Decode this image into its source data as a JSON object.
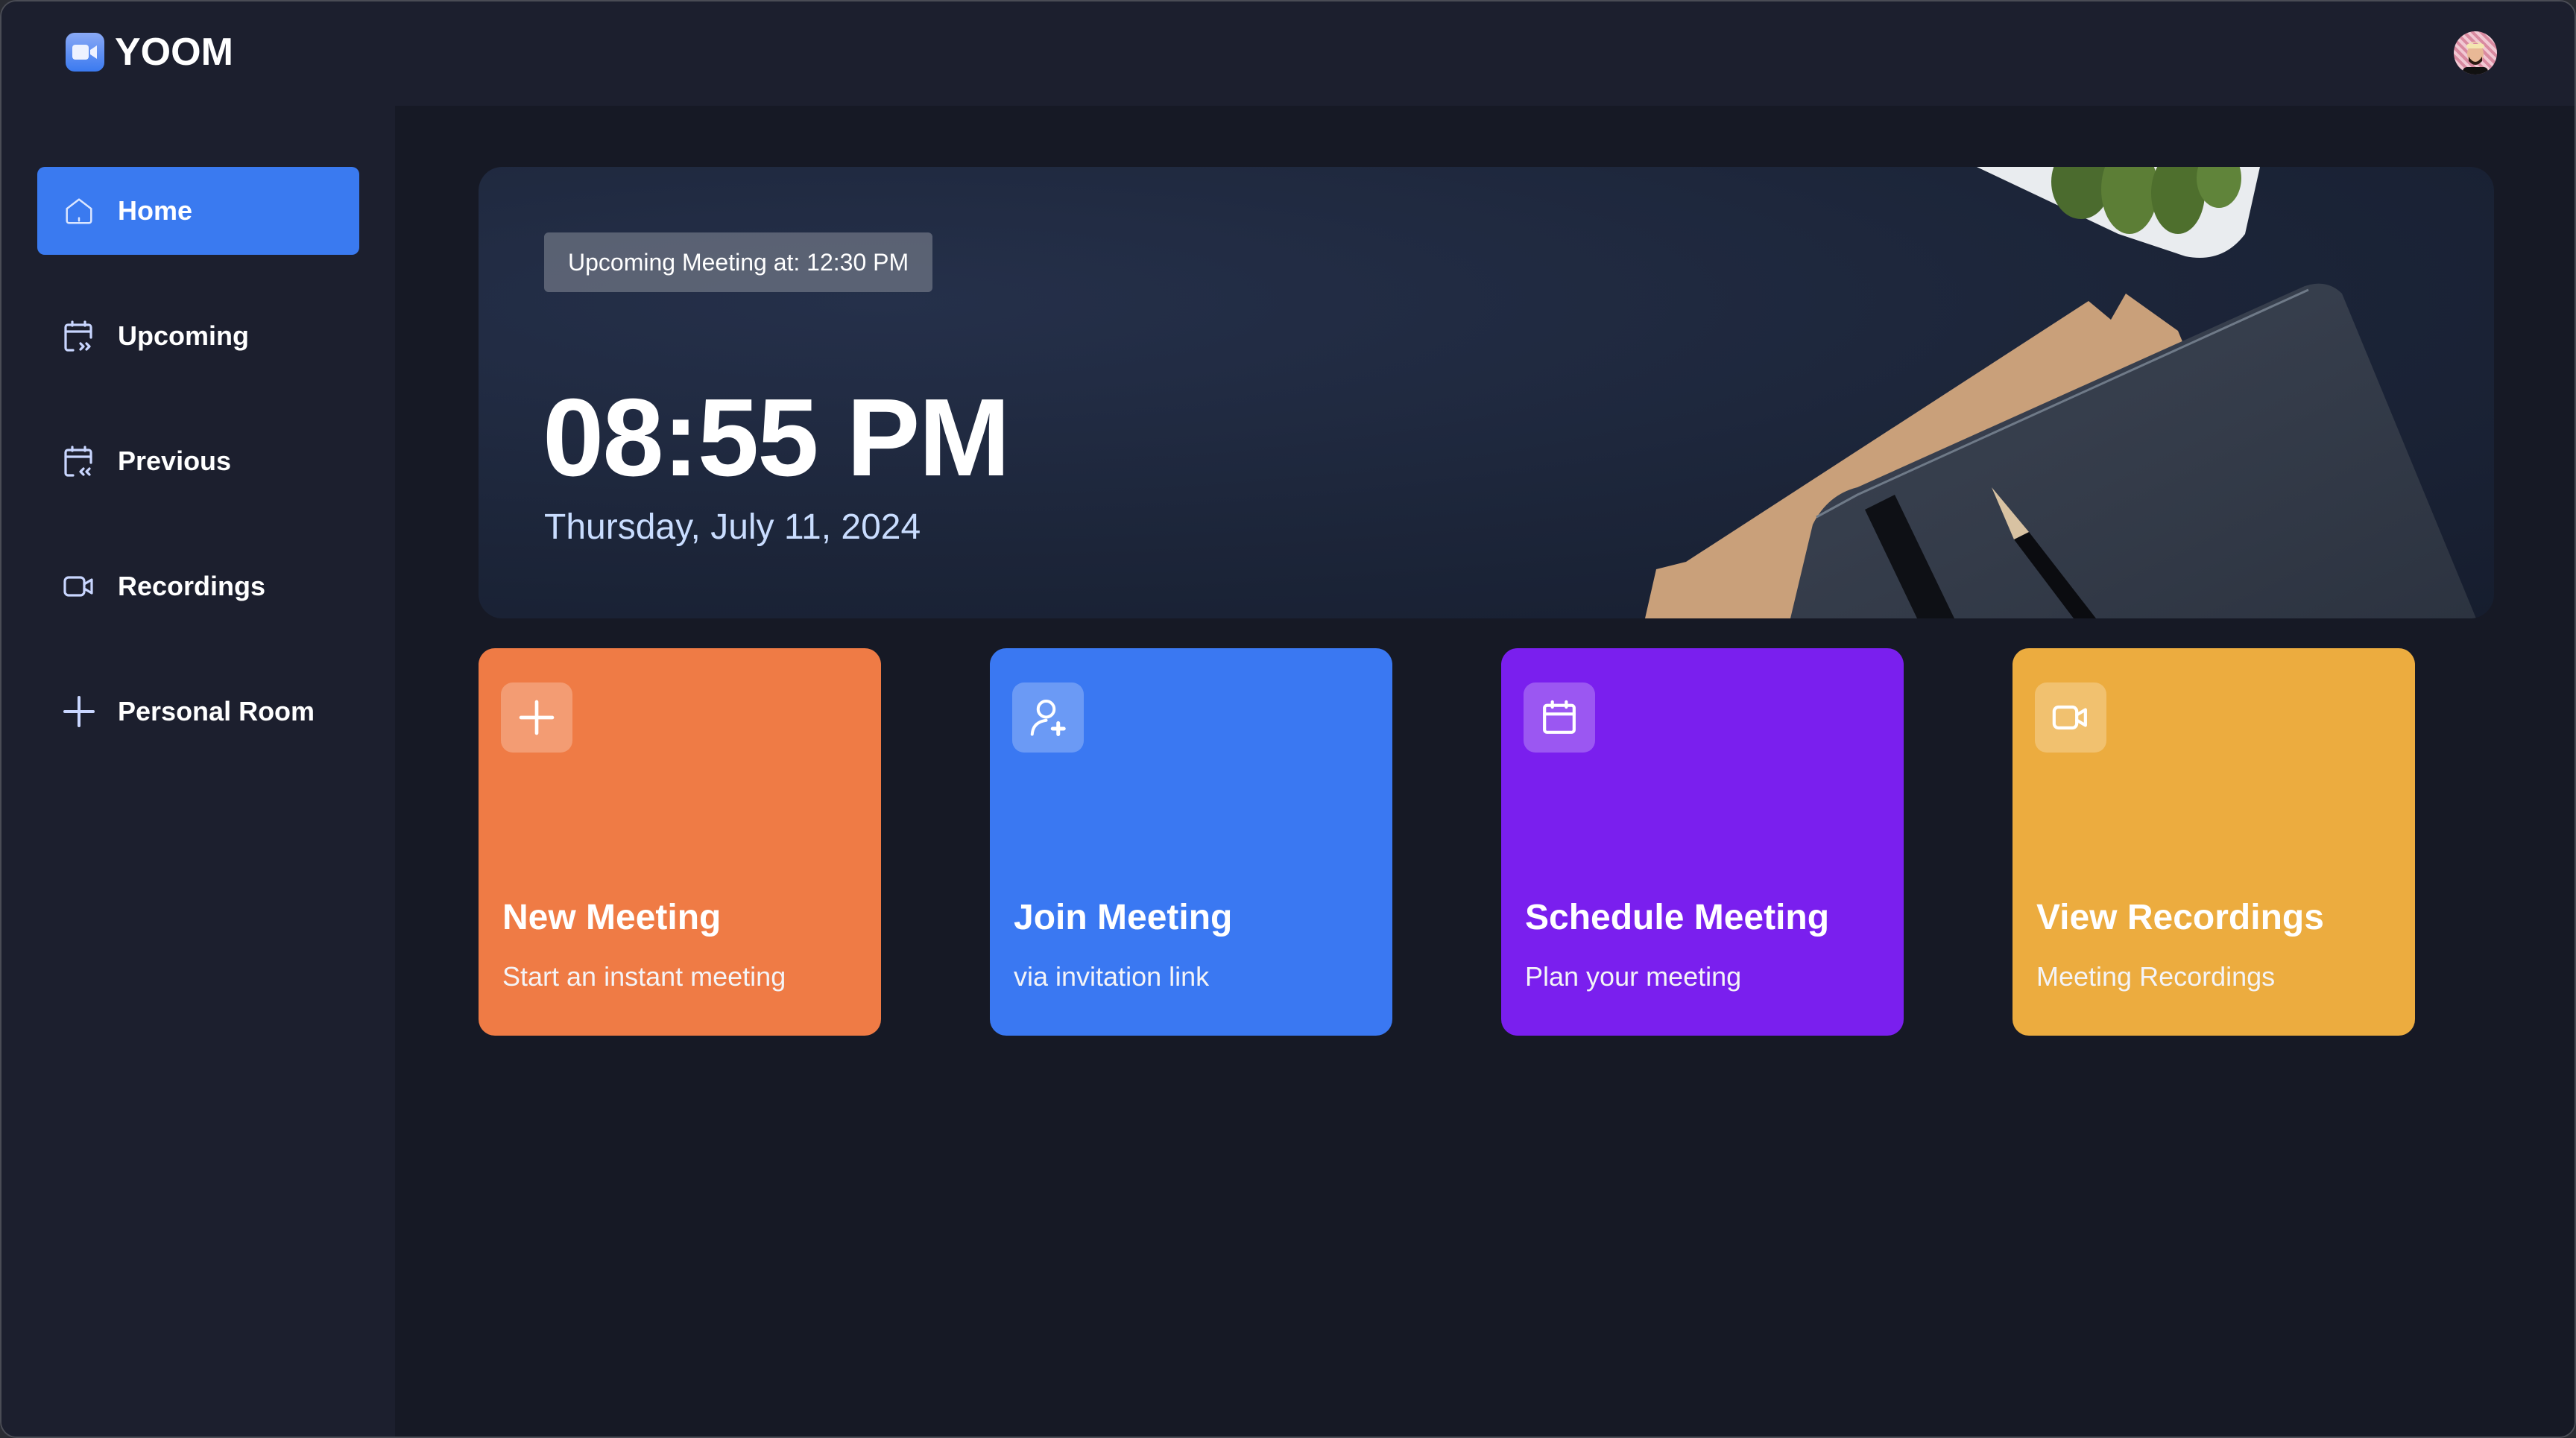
{
  "app": {
    "name": "YOOM",
    "logo_icon": "video-camera-icon"
  },
  "header": {
    "avatar_icon": "user-avatar"
  },
  "sidebar": {
    "items": [
      {
        "label": "Home",
        "icon": "home-icon",
        "active": true
      },
      {
        "label": "Upcoming",
        "icon": "calendar-upcoming-icon",
        "active": false
      },
      {
        "label": "Previous",
        "icon": "calendar-previous-icon",
        "active": false
      },
      {
        "label": "Recordings",
        "icon": "video-icon",
        "active": false
      },
      {
        "label": "Personal Room",
        "icon": "plus-icon",
        "active": false
      }
    ]
  },
  "hero": {
    "upcoming_label": "Upcoming Meeting at: 12:30 PM",
    "time": "08:55 PM",
    "date": "Thursday, July 11, 2024"
  },
  "cards": [
    {
      "title": "New Meeting",
      "subtitle": "Start an instant meeting",
      "icon": "plus-icon",
      "color": "#EF7B45"
    },
    {
      "title": "Join Meeting",
      "subtitle": "via invitation link",
      "icon": "user-add-icon",
      "color": "#3A78F2"
    },
    {
      "title": "Schedule Meeting",
      "subtitle": "Plan your meeting",
      "icon": "calendar-icon",
      "color": "#7A1FEE"
    },
    {
      "title": "View Recordings",
      "subtitle": "Meeting Recordings",
      "icon": "video-icon",
      "color": "#ECAC3F"
    }
  ],
  "colors": {
    "accent": "#3A7AF0",
    "sidebar_bg": "#1C1F2E",
    "main_bg": "#161925",
    "date_text": "#C9DDFF"
  }
}
